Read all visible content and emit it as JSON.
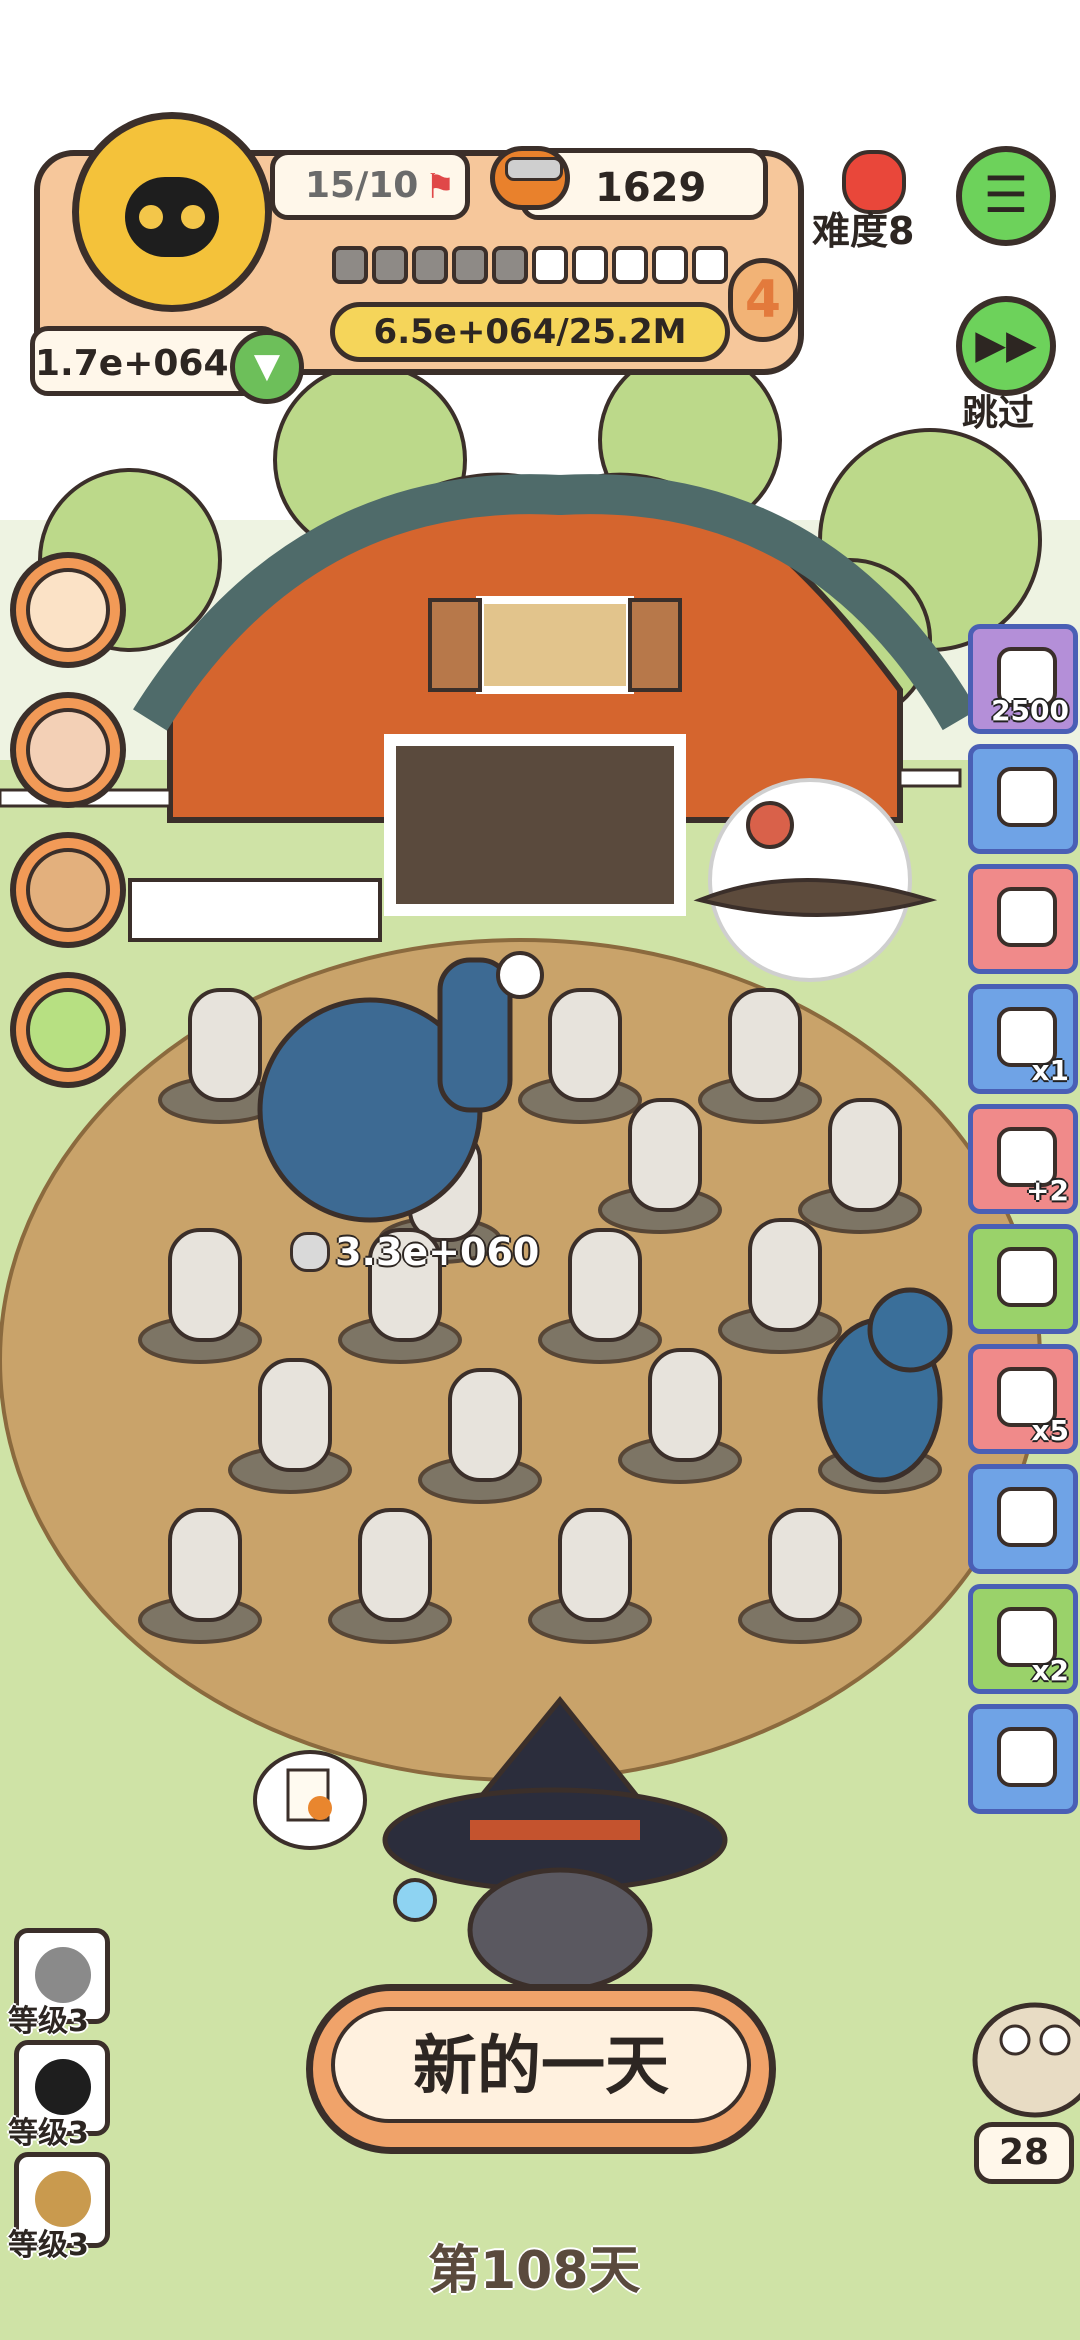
{
  "hud": {
    "level_progress": "15/10",
    "coins": "1629",
    "difficulty": "难度8",
    "level_number": "4",
    "xp_segments_total": 10,
    "xp_segments_filled": 5,
    "xp_text": "6.5e+064/25.2M",
    "wealth": "1.7e+064",
    "skip_label": "跳过"
  },
  "scene": {
    "herd_value": "3.3e+060"
  },
  "right_items": [
    {
      "name": "egg-item",
      "badge": "2500",
      "color": "#b48fd8"
    },
    {
      "name": "camera-item",
      "badge": "",
      "color": "#6fa3e6"
    },
    {
      "name": "fireball-item",
      "badge": "",
      "color": "#f08a8a"
    },
    {
      "name": "can-item",
      "badge": "x1",
      "color": "#6fa3e6"
    },
    {
      "name": "paw-bonus-item",
      "badge": "+2",
      "color": "#f08a8a"
    },
    {
      "name": "card-item",
      "badge": "",
      "color": "#9ad26a"
    },
    {
      "name": "rope-item",
      "badge": "x5",
      "color": "#f08a8a"
    },
    {
      "name": "trophy-item",
      "badge": "",
      "color": "#6fa3e6"
    },
    {
      "name": "tent-item",
      "badge": "x2",
      "color": "#9ad26a"
    },
    {
      "name": "sheep-item",
      "badge": "",
      "color": "#6fa3e6"
    }
  ],
  "levels": [
    {
      "label": "等级3"
    },
    {
      "label": "等级3"
    },
    {
      "label": "等级3"
    }
  ],
  "main_button": "新的一天",
  "day_label": "第108天",
  "owl_count": "28"
}
